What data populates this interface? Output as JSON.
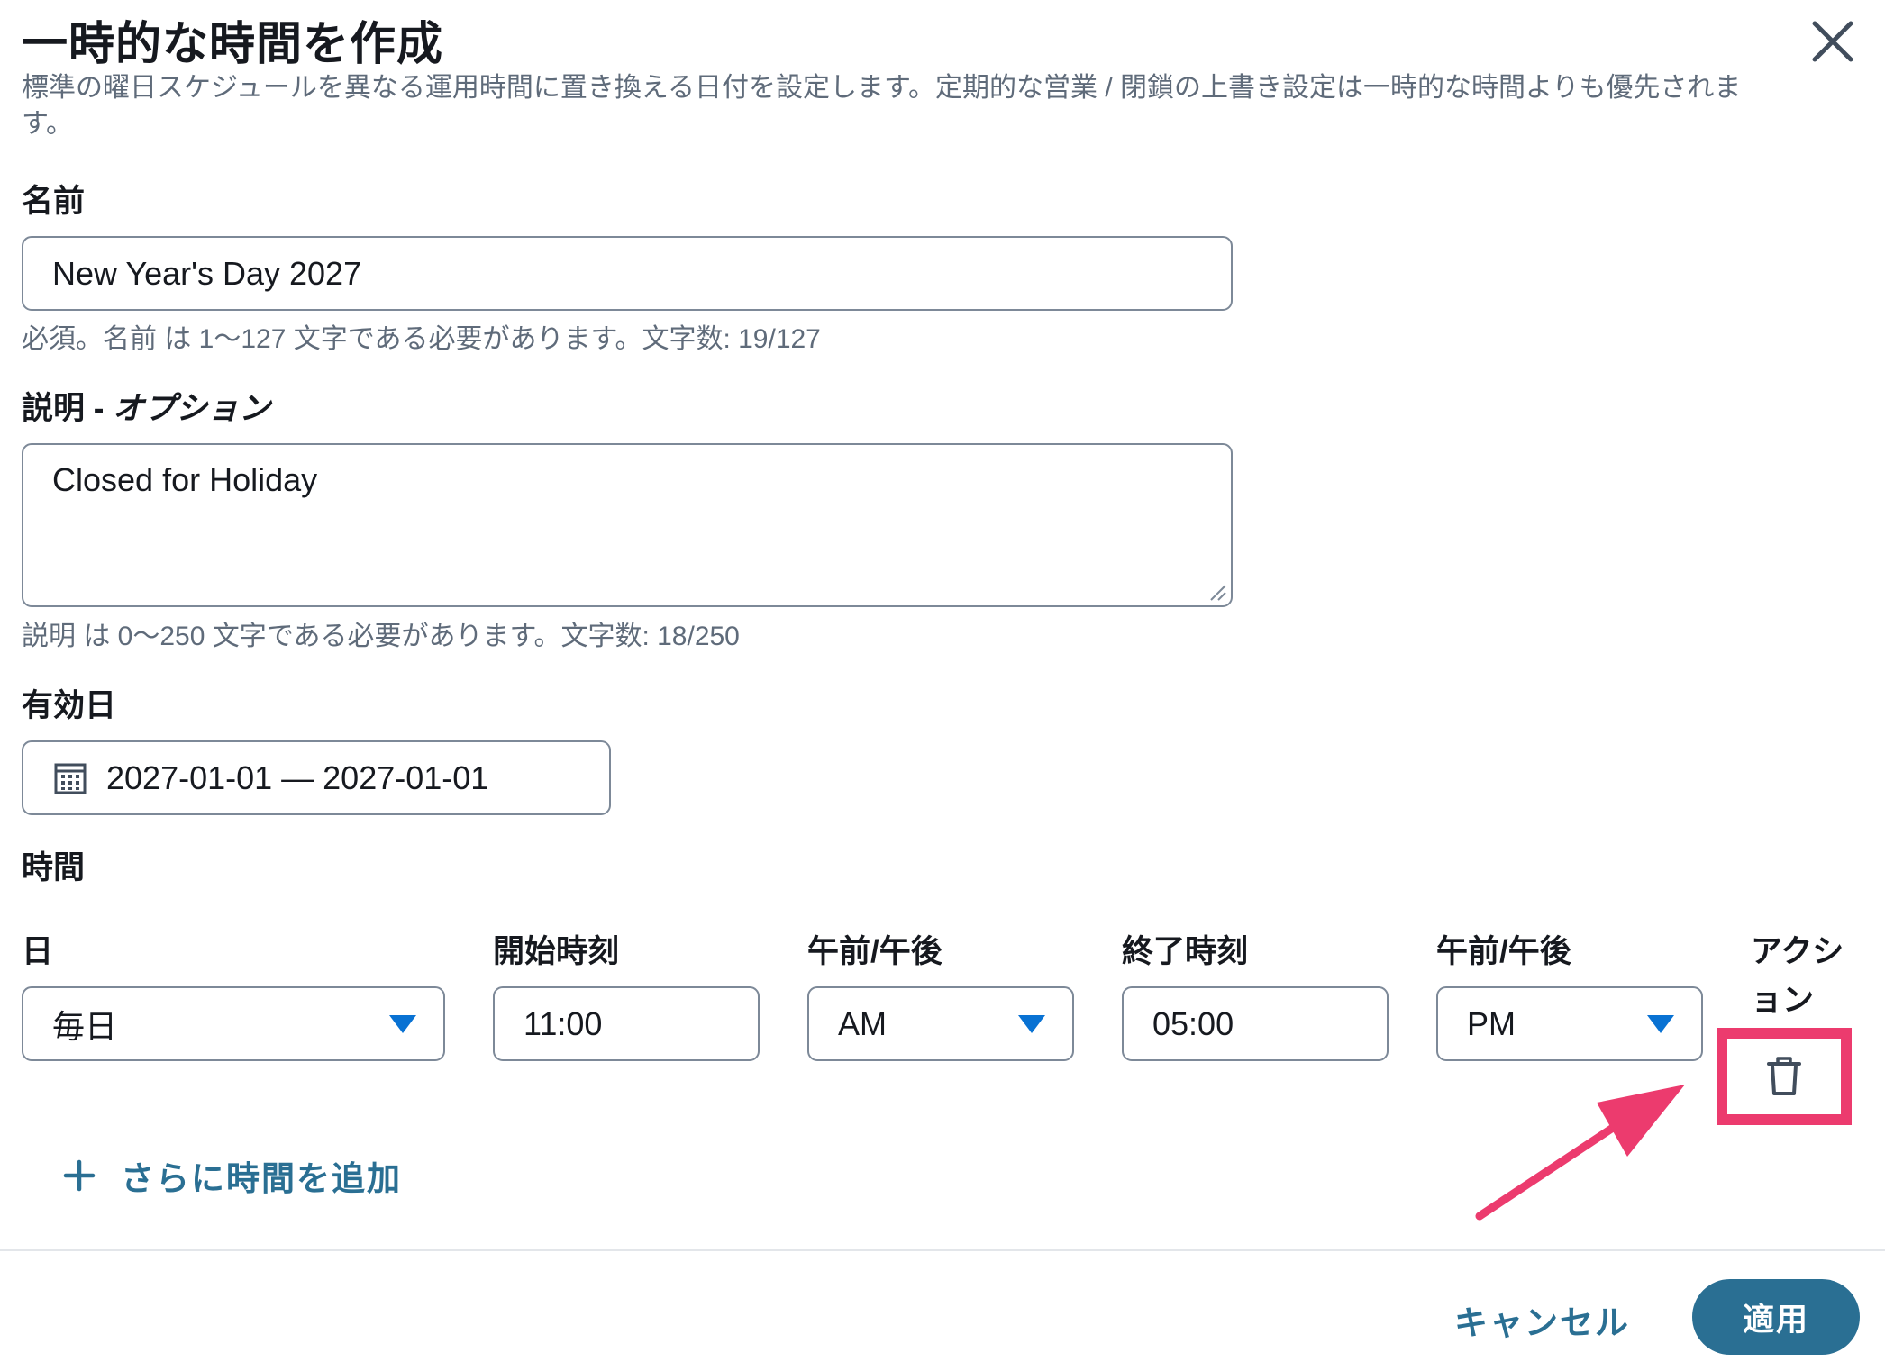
{
  "dialog": {
    "title": "一時的な時間を作成",
    "description": "標準の曜日スケジュールを異なる運用時間に置き換える日付を設定します。定期的な営業 / 閉鎖の上書き設定は一時的な時間よりも優先されます。"
  },
  "name_field": {
    "label": "名前",
    "value": "New Year's Day 2027",
    "hint": "必須。名前 は 1〜127 文字である必要があります。文字数: 19/127"
  },
  "description_field": {
    "label": "説明 - ",
    "label_optional": "オプション",
    "value": "Closed for Holiday",
    "hint": "説明 は 0〜250 文字である必要があります。文字数: 18/250"
  },
  "effective_date": {
    "label": "有効日",
    "icon": "calendar-icon",
    "value": "2027-01-01 — 2027-01-01"
  },
  "hours": {
    "section_label": "時間",
    "columns": {
      "day": "日",
      "start_time": "開始時刻",
      "start_ampm": "午前/午後",
      "end_time": "終了時刻",
      "end_ampm": "午前/午後",
      "actions_line1": "アクシ",
      "actions_line2": "ョン"
    },
    "rows": [
      {
        "day": "毎日",
        "start_time": "11:00",
        "start_ampm": "AM",
        "end_time": "05:00",
        "end_ampm": "PM",
        "action_icon": "trash-icon"
      }
    ],
    "add_more_label": "さらに時間を追加"
  },
  "footer": {
    "cancel_label": "キャンセル",
    "apply_label": "適用"
  },
  "annotation": {
    "highlight_color": "#ec3b6e"
  },
  "colors": {
    "link": "#2a6f93",
    "caret": "#0972d3",
    "primary_button": "#2a6f93"
  }
}
